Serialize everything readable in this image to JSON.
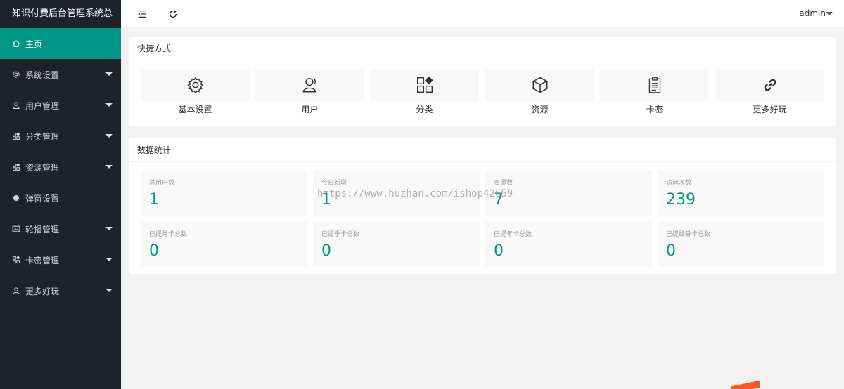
{
  "app": {
    "title": "知识付费后台管理系统总"
  },
  "sidebar": {
    "items": [
      {
        "label": "主页",
        "icon": "home-icon",
        "active": true,
        "caret": false
      },
      {
        "label": "系统设置",
        "icon": "gear-icon",
        "active": false,
        "caret": true
      },
      {
        "label": "用户管理",
        "icon": "user-icon",
        "active": false,
        "caret": true
      },
      {
        "label": "分类管理",
        "icon": "apps-icon",
        "active": false,
        "caret": true
      },
      {
        "label": "资源管理",
        "icon": "apps-icon",
        "active": false,
        "caret": true
      },
      {
        "label": "弹窗设置",
        "icon": "circle-icon",
        "active": false,
        "caret": false
      },
      {
        "label": "轮播管理",
        "icon": "picture-icon",
        "active": false,
        "caret": true
      },
      {
        "label": "卡密管理",
        "icon": "apps-icon",
        "active": false,
        "caret": true
      },
      {
        "label": "更多好玩",
        "icon": "user-icon",
        "active": false,
        "caret": true
      }
    ]
  },
  "header": {
    "menu_icon": "shrink-menu-icon",
    "refresh_icon": "refresh-icon",
    "user": "admin"
  },
  "shortcuts": {
    "title": "快捷方式",
    "items": [
      {
        "label": "基本设置",
        "icon": "gear-icon"
      },
      {
        "label": "用户",
        "icon": "user-icon"
      },
      {
        "label": "分类",
        "icon": "apps-icon"
      },
      {
        "label": "资源",
        "icon": "cube-icon"
      },
      {
        "label": "卡密",
        "icon": "clipboard-icon"
      },
      {
        "label": "更多好玩",
        "icon": "link-icon"
      }
    ]
  },
  "stats": {
    "title": "数据统计",
    "items": [
      {
        "label": "总用户数",
        "value": "1"
      },
      {
        "label": "今日新增",
        "value": "1"
      },
      {
        "label": "资源数",
        "value": "7"
      },
      {
        "label": "访问次数",
        "value": "239"
      },
      {
        "label": "已提月卡总数",
        "value": "0"
      },
      {
        "label": "已提季卡总数",
        "value": "0"
      },
      {
        "label": "已提年卡总数",
        "value": "0"
      },
      {
        "label": "已提终身卡总数",
        "value": "0"
      }
    ]
  },
  "watermark": "https://www.huzhan.com/ishop42659",
  "colors": {
    "accent": "#009688",
    "sidebar": "#20222a"
  }
}
